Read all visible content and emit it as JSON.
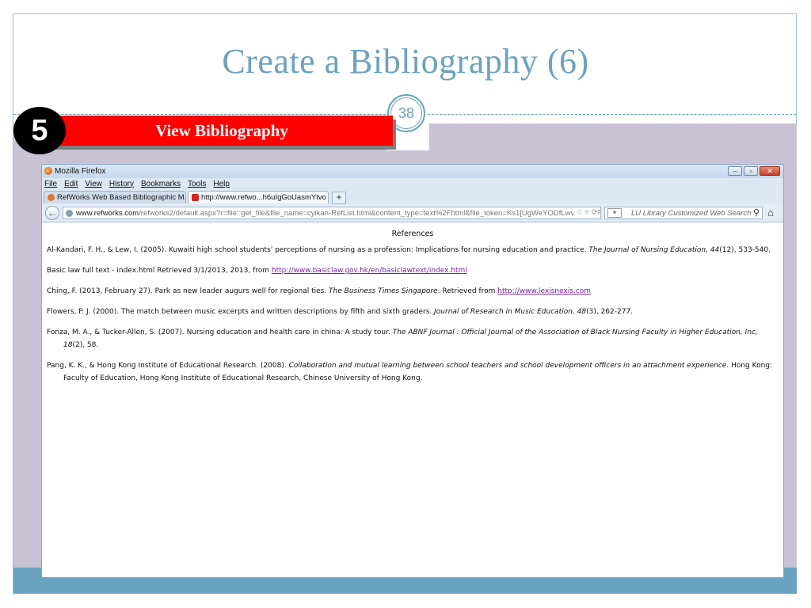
{
  "slide": {
    "title": "Create a Bibliography (6)",
    "page_number": "38",
    "step_number": "5",
    "step_label": "View Bibliography"
  },
  "browser": {
    "window_title": "Mozilla Firefox",
    "menu": [
      "File",
      "Edit",
      "View",
      "History",
      "Bookmarks",
      "Tools",
      "Help"
    ],
    "tabs": [
      {
        "label": "RefWorks Web Based Bibliographic M...",
        "close": "×"
      },
      {
        "label": "http://www.refwo...h6uIgGoUasmYtvo",
        "close": "×"
      }
    ],
    "new_tab": "+",
    "url": {
      "host": "www.refworks.com",
      "path": "/refworks2/default.aspx?r=file::get_file&file_name=cyikan-RefList.html&content_type=text%2Fhtml&file_token=Ks1[UgWeYODfLwvfLEW_FW"
    },
    "search_placeholder": "LU Library Customized Web Search",
    "window_buttons": {
      "minimize": "–",
      "maximize": "▫",
      "close": "✕"
    }
  },
  "references": {
    "heading": "References",
    "items": [
      {
        "before": "Al-Kandari, F. H., & Lew, I. (2005). Kuwaiti high school students' perceptions of nursing as a profession: Implications for nursing education and practice. ",
        "italic": "The Journal of Nursing Education, 44",
        "after": "(12), 533-540.",
        "link": ""
      },
      {
        "before": "Basic law full text - index.html Retrieved 3/1/2013, 2013, from ",
        "italic": "",
        "after": "",
        "link": "http://www.basiclaw.gov.hk/en/basiclawtext/index.html"
      },
      {
        "before": "Ching, F. (2013, February 27). Park as new leader augurs well for regional ties. ",
        "italic": "The Business Times Singapore",
        "after": ". Retrieved from ",
        "link": "http://www.lexisnexis.com"
      },
      {
        "before": "Flowers, P. J. (2000). The match between music excerpts and written descriptions by fifth and sixth graders. ",
        "italic": "Journal of Research in Music Education, 48",
        "after": "(3), 262-277.",
        "link": ""
      },
      {
        "before": "Fonza, M. A., & Tucker-Allen, S. (2007). Nursing education and health care in china: A study tour. ",
        "italic": "The ABNF Journal : Official Journal of the Association of Black Nursing Faculty in Higher Education, Inc, 18",
        "after": "(2), 58.",
        "link": ""
      },
      {
        "before": "Pang, K. K., & Hong Kong Institute of Educational Research. (2008). ",
        "italic": "Collaboration and mutual learning between school teachers and school development officers in an attachment experience",
        "after": ". Hong Kong: Faculty of Education, Hong Kong Institute of Educational Research, Chinese University of Hong Kong.",
        "link": ""
      }
    ]
  }
}
